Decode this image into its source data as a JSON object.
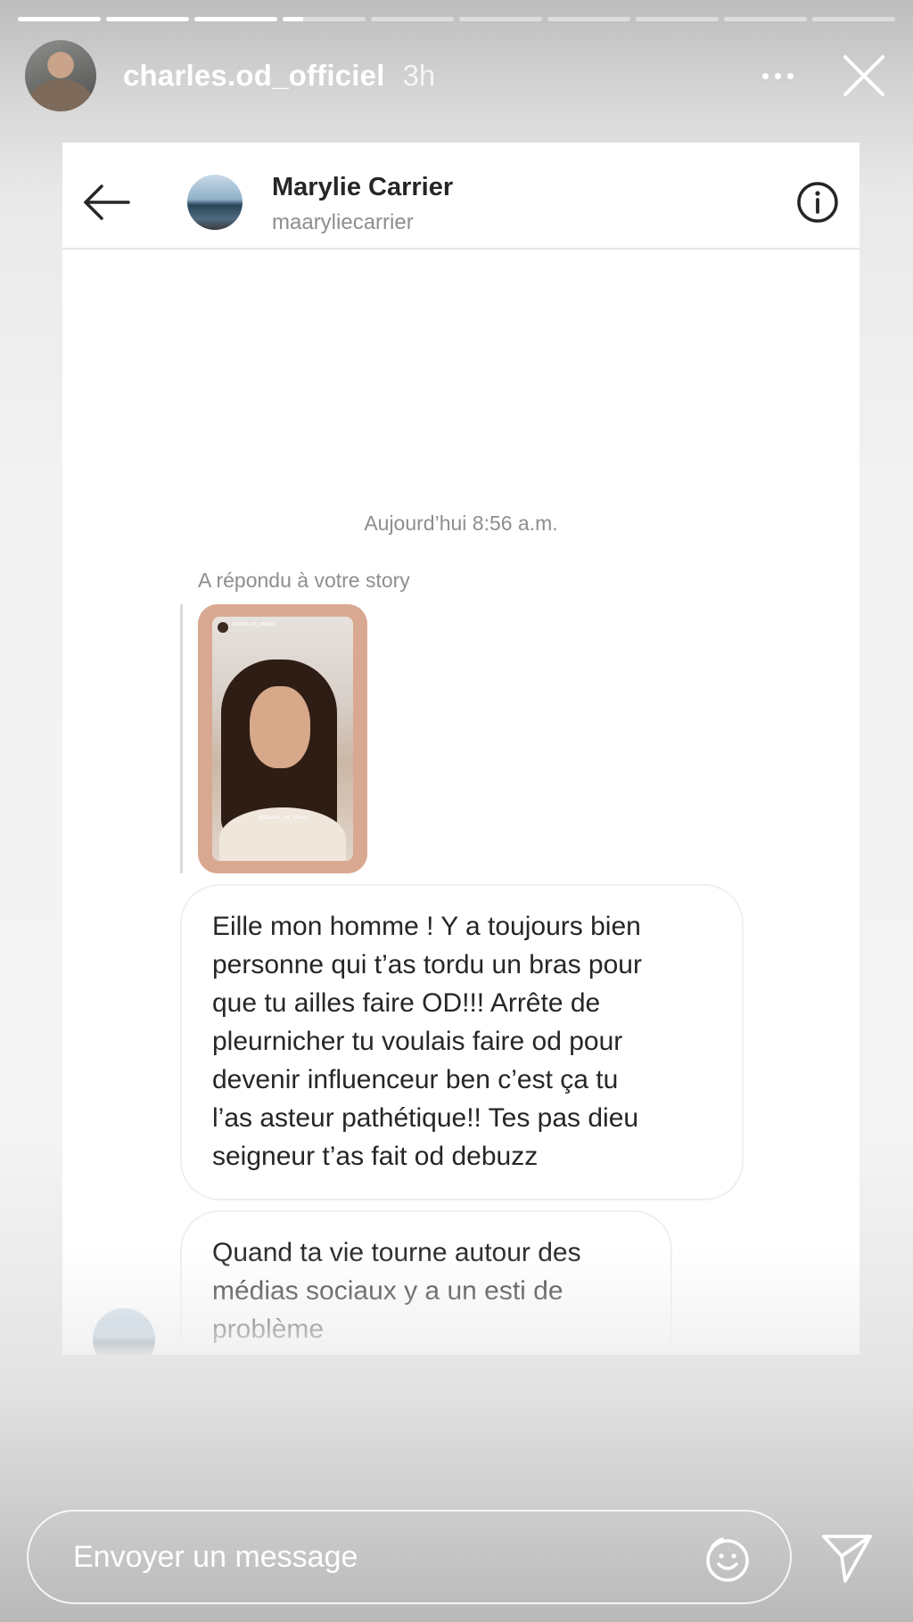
{
  "story": {
    "progress": [
      1,
      1,
      1,
      0.25,
      0,
      0,
      0,
      0,
      0,
      0
    ],
    "username": "charles.od_officiel",
    "time": "3h",
    "more_icon": "more-dots-icon",
    "close_icon": "close-icon"
  },
  "dm": {
    "contact_name": "Marylie Carrier",
    "contact_handle": "maaryliecarrier",
    "timestamp": "Aujourd’hui 8:56 a.m.",
    "reply_label": "A répondu à votre story",
    "story_thumb": {
      "username": "charles.od_officiel",
      "caption_mention": "@charles_od_officiel"
    },
    "messages": [
      {
        "lines": [
          "Eille mon homme ! Y a toujours bien",
          "personne qui t’as tordu un bras pour",
          "que tu ailles faire OD!!! Arrête de",
          "pleurnicher tu voulais faire od pour",
          "devenir influenceur ben c’est ça tu",
          "l’as asteur pathétique!! Tes pas dieu",
          "seigneur t’as fait od debuzz"
        ]
      },
      {
        "lines": [
          "Quand ta vie tourne autour des",
          "médias sociaux y a un esti de",
          "problème"
        ]
      }
    ]
  },
  "composer": {
    "placeholder": "Envoyer un message",
    "emoji_icon": "emoji-reaction-icon",
    "send_icon": "send-icon"
  },
  "colors": {
    "text_primary": "#262626",
    "text_secondary": "#8e8e8e",
    "bubble_border": "#efefef"
  }
}
